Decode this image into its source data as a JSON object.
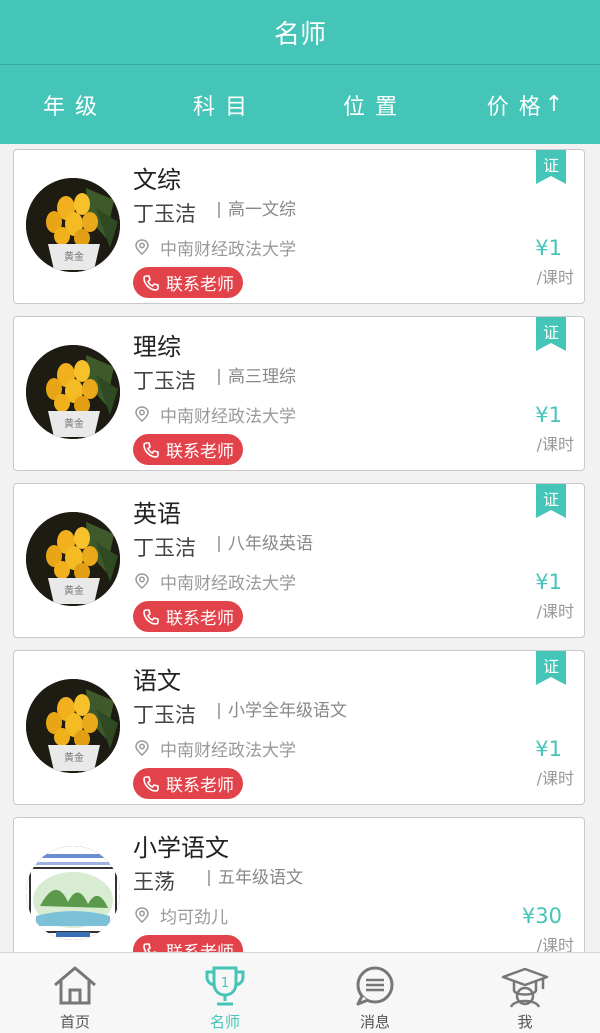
{
  "header": {
    "title": "名师"
  },
  "filters": [
    {
      "label": "年级",
      "arrow": ""
    },
    {
      "label": "科目",
      "arrow": ""
    },
    {
      "label": "位置",
      "arrow": ""
    },
    {
      "label": "价格",
      "arrow": "↑"
    }
  ],
  "cards": [
    {
      "subject": "文综",
      "teacher": "丁玉洁",
      "grade": "高一文综",
      "school": "中南财经政法大学",
      "contact": "联系老师",
      "badge": "证",
      "price": "¥1",
      "unit": "/课时",
      "avatar": "yellow-flower-pot"
    },
    {
      "subject": "理综",
      "teacher": "丁玉洁",
      "grade": "高三理综",
      "school": "中南财经政法大学",
      "contact": "联系老师",
      "badge": "证",
      "price": "¥1",
      "unit": "/课时",
      "avatar": "yellow-flower-pot"
    },
    {
      "subject": "英语",
      "teacher": "丁玉洁",
      "grade": "八年级英语",
      "school": "中南财经政法大学",
      "contact": "联系老师",
      "badge": "证",
      "price": "¥1",
      "unit": "/课时",
      "avatar": "yellow-flower-pot"
    },
    {
      "subject": "语文",
      "teacher": "丁玉洁",
      "grade": "小学全年级语文",
      "school": "中南财经政法大学",
      "contact": "联系老师",
      "badge": "证",
      "price": "¥1",
      "unit": "/课时",
      "avatar": "yellow-flower-pot"
    },
    {
      "subject": "小学语文",
      "teacher": "王荡",
      "grade": "五年级语文",
      "school": "均可劲儿",
      "contact": "联系老师",
      "badge": "",
      "price": "¥30",
      "unit": "/课时",
      "avatar": "landscape-painting"
    }
  ],
  "tabbar": [
    {
      "label": "首页",
      "icon": "home-icon",
      "active": false
    },
    {
      "label": "名师",
      "icon": "trophy-icon",
      "active": true
    },
    {
      "label": "消息",
      "icon": "message-icon",
      "active": false
    },
    {
      "label": "我",
      "icon": "graduation-cap-icon",
      "active": false
    }
  ],
  "colors": {
    "primary": "#45c4b8",
    "contact": "#e2434a",
    "price": "#45c4b8"
  }
}
